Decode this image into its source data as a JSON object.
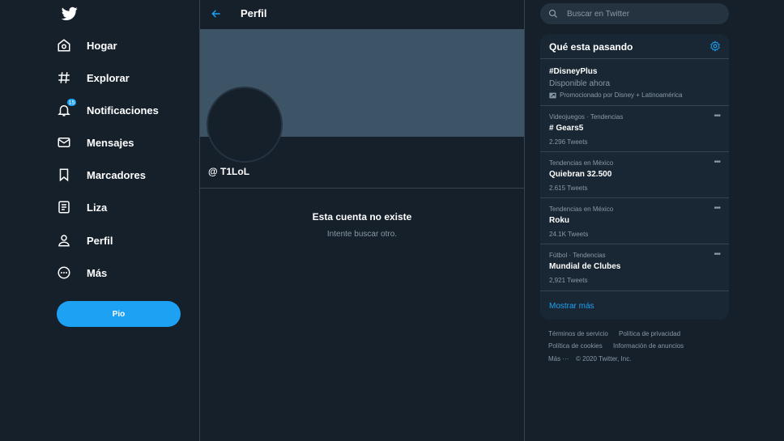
{
  "sidebar": {
    "items": [
      {
        "label": "Hogar",
        "icon": "home-icon"
      },
      {
        "label": "Explorar",
        "icon": "hashtag-icon"
      },
      {
        "label": "Notificaciones",
        "icon": "bell-icon",
        "badge": "15"
      },
      {
        "label": "Mensajes",
        "icon": "envelope-icon"
      },
      {
        "label": "Marcadores",
        "icon": "bookmark-icon"
      },
      {
        "label": "Liza",
        "icon": "list-icon"
      },
      {
        "label": "Perfil",
        "icon": "person-icon"
      },
      {
        "label": "Más",
        "icon": "more-circle-icon"
      }
    ],
    "tweet_button": "Pio"
  },
  "main": {
    "title": "Perfil",
    "handle": "@ T1LoL",
    "empty_title": "Esta cuenta no existe",
    "empty_subtitle": "Intente buscar otro."
  },
  "right": {
    "search_placeholder": "Buscar en Twitter",
    "trends_title": "Qué esta pasando",
    "promoted": {
      "name": "#DisneyPlus",
      "subtitle": "Disponible ahora",
      "promoted_by": "Promocionado por Disney + Latinoamérica"
    },
    "trends": [
      {
        "meta": "Videojuegos · Tendencias",
        "name": "# Gears5",
        "count": "2.296 Tweets"
      },
      {
        "meta": "Tendencias en México",
        "name": "Quiebran 32.500",
        "count": "2.615 Tweets"
      },
      {
        "meta": "Tendencias en México",
        "name": "Roku",
        "count": "24.1K Tweets"
      },
      {
        "meta": "Fútbol · Tendencias",
        "name": "Mundial de Clubes",
        "count": "2,921 Tweets"
      }
    ],
    "show_more": "Mostrar más",
    "footer": {
      "terms": "Términos de servicio",
      "privacy": "Política de privacidad",
      "cookies": "Política de cookies",
      "ads": "Información de anuncios",
      "more": "Más ···",
      "copyright": "© 2020 Twitter, Inc."
    }
  },
  "colors": {
    "background": "#15202b",
    "accent": "#1da1f2",
    "banner": "#3d5466",
    "panel": "#192734",
    "muted": "#8899a6"
  }
}
